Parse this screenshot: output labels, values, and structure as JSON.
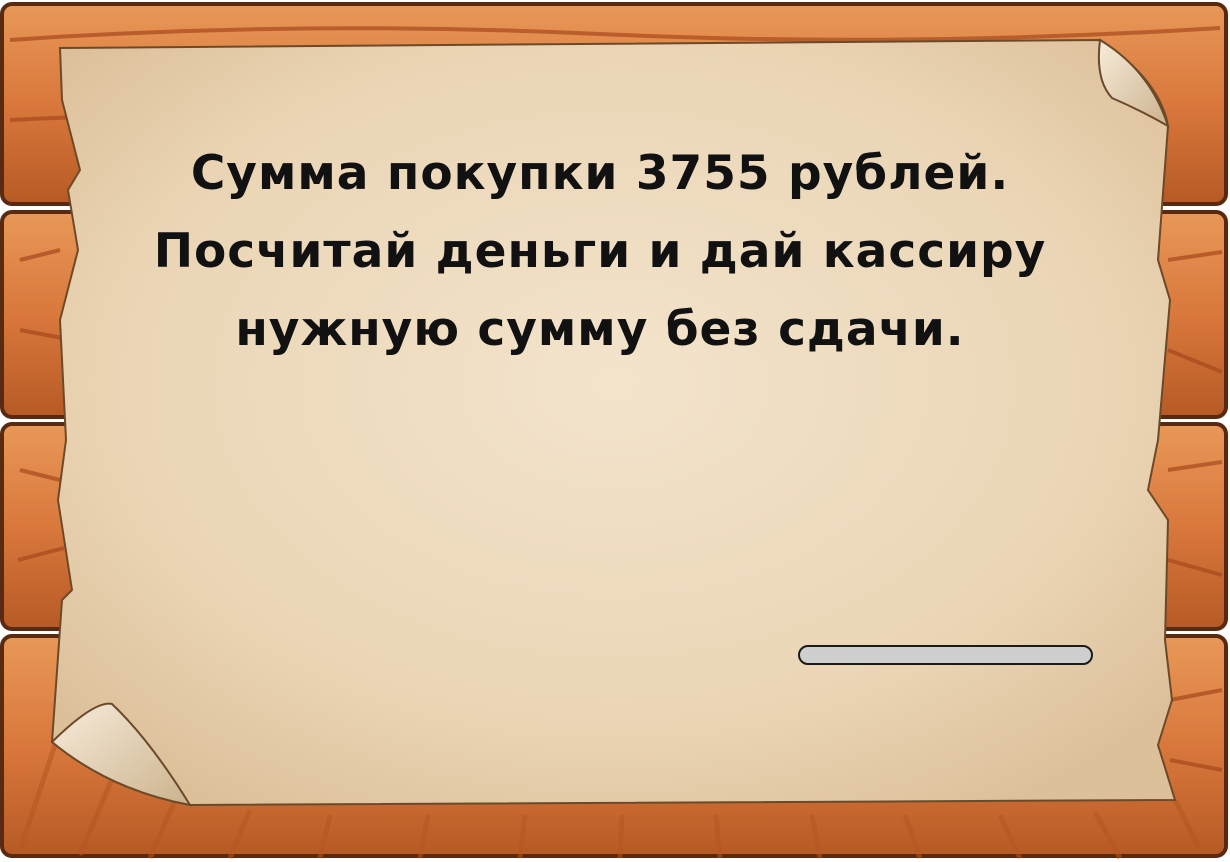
{
  "task": {
    "lines": [
      "Сумма покупки 3755 рублей.",
      "Посчитай деньги и дай кассиру",
      "нужную сумму без сдачи."
    ]
  },
  "answer_field": {
    "value": ""
  },
  "colors": {
    "wood_light": "#e0894a",
    "wood_dark": "#a7481d",
    "wood_outline": "#5a2a10",
    "parchment": "#ecd9bd",
    "parchment_center": "#f2e3cb",
    "text": "#111111",
    "field": "#cfcfcf"
  }
}
